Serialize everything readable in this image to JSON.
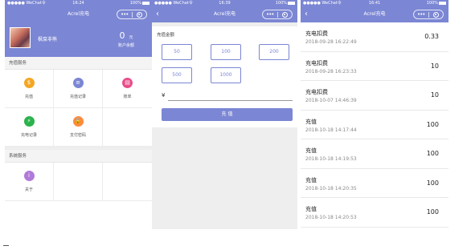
{
  "status": {
    "carrier": "●●●●● WeChat令",
    "battery": "100%",
    "times": [
      "16:24",
      "16:39",
      "16:41"
    ]
  },
  "app": {
    "title": "Acrel充电"
  },
  "screen1": {
    "username": "枫泵非熊",
    "balance_value": "0",
    "balance_unit": "元",
    "balance_label": "账户余额",
    "section1": "充值服务",
    "services": [
      {
        "label": "充值",
        "icon": "money-bag-icon",
        "color": "#f5a623",
        "glyph": "$"
      },
      {
        "label": "充值记录",
        "icon": "record-icon",
        "color": "#7b86d4",
        "glyph": "≡"
      },
      {
        "label": "账单",
        "icon": "bill-icon",
        "color": "#e84e8a",
        "glyph": "▤"
      },
      {
        "label": "充电记录",
        "icon": "lightning-icon",
        "color": "#2bb24c",
        "glyph": "⚡"
      },
      {
        "label": "支付密码",
        "icon": "lock-icon",
        "color": "#ff8a3d",
        "glyph": "🔒"
      }
    ],
    "section2": "系统服务",
    "system": [
      {
        "label": "关于",
        "icon": "info-icon",
        "color": "#b07ad9",
        "glyph": "i"
      }
    ]
  },
  "screen2": {
    "header": "充值金额",
    "amounts": [
      "50",
      "100",
      "200",
      "500",
      "1000"
    ],
    "currency": "¥",
    "input_value": "",
    "pay_label": "充 值"
  },
  "screen3": {
    "records": [
      {
        "title": "充电扣费",
        "time": "2018-09-28 16:22:49",
        "value": "0.33"
      },
      {
        "title": "充电扣费",
        "time": "2018-09-28 16:23:33",
        "value": "10"
      },
      {
        "title": "充电扣费",
        "time": "2018-10-07 14:46:39",
        "value": "10"
      },
      {
        "title": "充值",
        "time": "2018-10-18 14:17:44",
        "value": "100"
      },
      {
        "title": "充值",
        "time": "2018-10-18 14:19:53",
        "value": "100"
      },
      {
        "title": "充值",
        "time": "2018-10-18 14:20:35",
        "value": "100"
      },
      {
        "title": "充值",
        "time": "2018-10-18 14:20:53",
        "value": "100"
      }
    ]
  },
  "colors": {
    "primary": "#7b86d4"
  }
}
